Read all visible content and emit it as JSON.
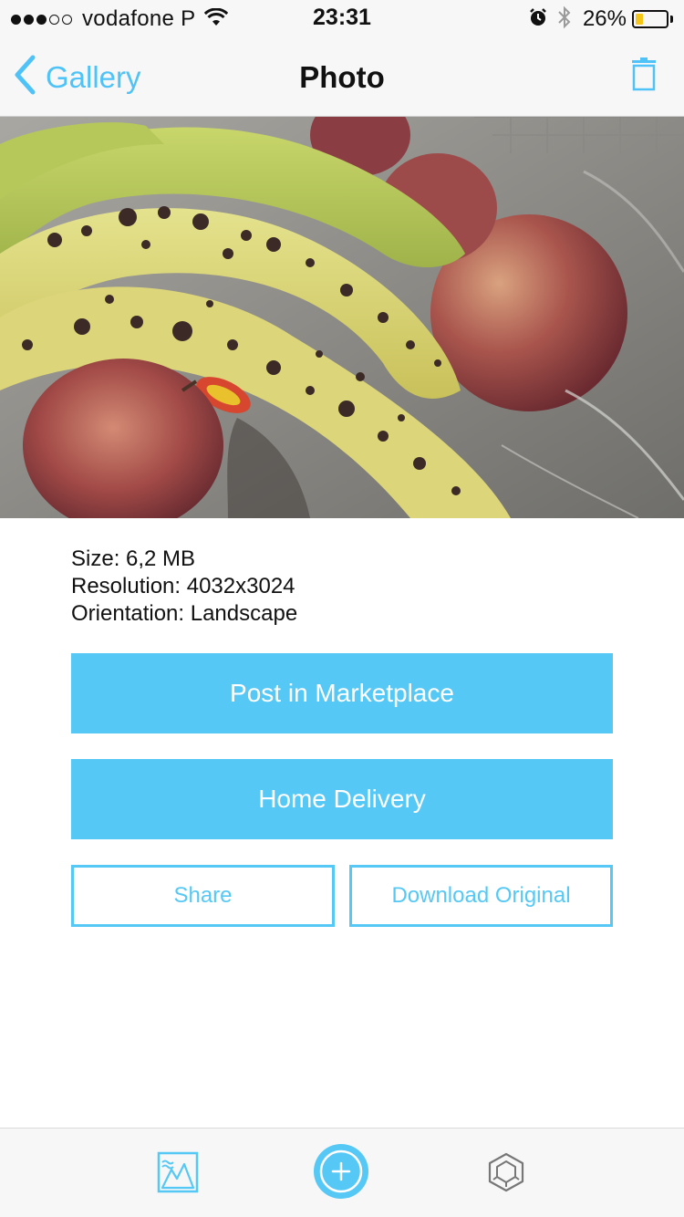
{
  "status_bar": {
    "signal_bars_filled": 3,
    "signal_bars_total": 5,
    "carrier": "vodafone P",
    "time": "23:31",
    "battery_percent_text": "26%",
    "battery_level": 0.26,
    "battery_color": "#f5c518"
  },
  "nav": {
    "back_label": "Gallery",
    "title": "Photo",
    "icons": {
      "back": "chevron-left-icon",
      "delete": "trash-icon"
    },
    "accent_color": "#4fc3f7"
  },
  "photo": {
    "subject": "bananas-and-apples"
  },
  "details": {
    "size": "Size: 6,2 MB",
    "resolution": "Resolution: 4032x3024",
    "orientation": "Orientation: Landscape"
  },
  "actions": {
    "post_marketplace": "Post in Marketplace",
    "home_delivery": "Home Delivery",
    "share": "Share",
    "download_original": "Download Original",
    "button_color": "#55c8f5"
  },
  "tab_bar": {
    "icons": [
      "gallery-icon",
      "add-icon",
      "marketplace-icon"
    ]
  }
}
